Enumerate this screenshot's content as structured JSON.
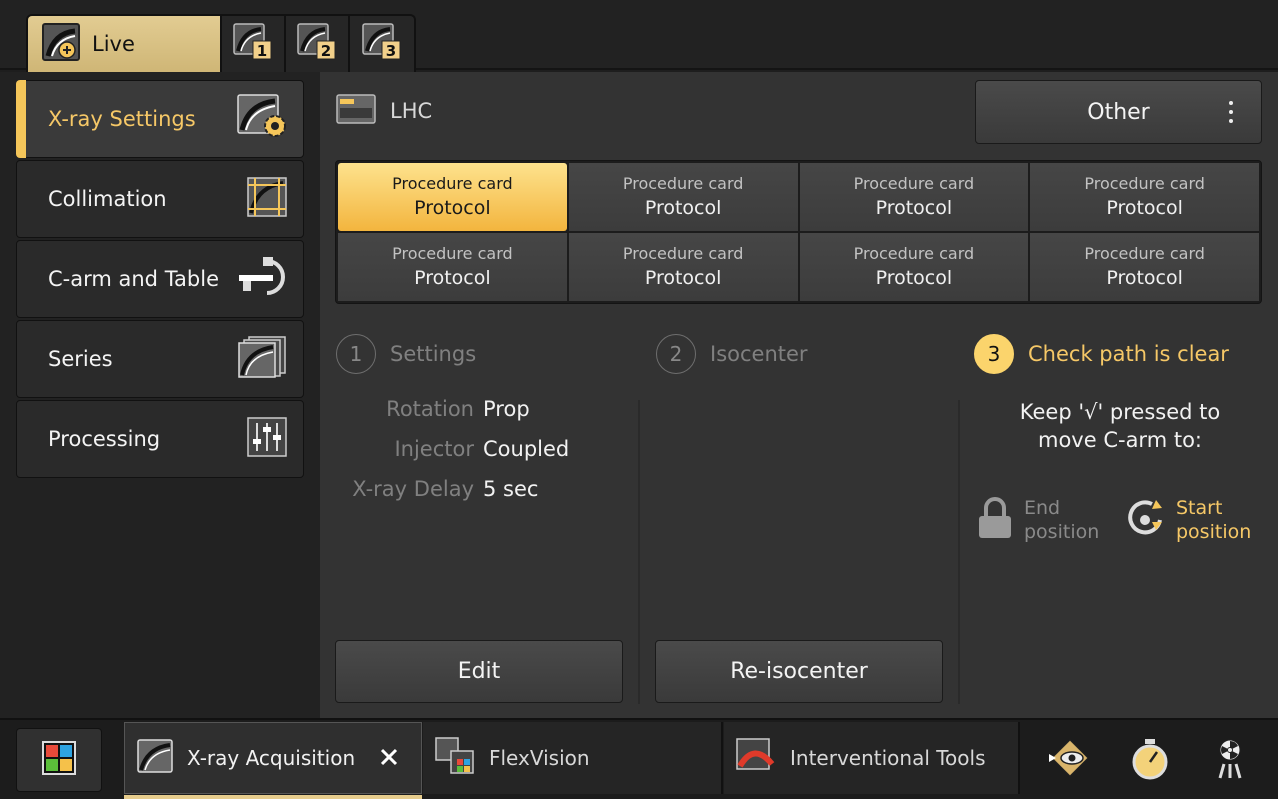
{
  "top_tabs": [
    {
      "label": "Live",
      "icon": "live-acquisition-icon",
      "active": true
    },
    {
      "number": "1",
      "icon": "viewport-1-icon"
    },
    {
      "number": "2",
      "icon": "viewport-2-icon"
    },
    {
      "number": "3",
      "icon": "viewport-3-icon"
    }
  ],
  "left_menu": [
    {
      "label": "X-ray Settings",
      "icon": "xray-settings-gear-icon",
      "active": true
    },
    {
      "label": "Collimation",
      "icon": "collimation-icon"
    },
    {
      "label": "C-arm and Table",
      "icon": "c-arm-table-icon"
    },
    {
      "label": "Series",
      "icon": "series-icon"
    },
    {
      "label": "Processing",
      "icon": "processing-sliders-icon"
    }
  ],
  "header": {
    "procedure": "LHC",
    "other_label": "Other"
  },
  "procedure_cards": [
    {
      "title": "Procedure card",
      "subtitle": "Protocol",
      "selected": true
    },
    {
      "title": "Procedure card",
      "subtitle": "Protocol"
    },
    {
      "title": "Procedure card",
      "subtitle": "Protocol"
    },
    {
      "title": "Procedure card",
      "subtitle": "Protocol"
    },
    {
      "title": "Procedure card",
      "subtitle": "Protocol"
    },
    {
      "title": "Procedure card",
      "subtitle": "Protocol"
    },
    {
      "title": "Procedure card",
      "subtitle": "Protocol"
    },
    {
      "title": "Procedure card",
      "subtitle": "Protocol"
    }
  ],
  "steps": [
    {
      "number": "1",
      "label": "Settings",
      "active": false
    },
    {
      "number": "2",
      "label": "Isocenter",
      "active": false
    },
    {
      "number": "3",
      "label": "Check path is clear",
      "active": true
    }
  ],
  "settings": [
    {
      "key": "Rotation",
      "value": "Prop"
    },
    {
      "key": "Injector",
      "value": "Coupled"
    },
    {
      "key": "X-ray Delay",
      "value": "5 sec"
    }
  ],
  "check_path": {
    "instruction_line1": "Keep '√' pressed to",
    "instruction_line2": "move C-arm to:",
    "end_line1": "End",
    "end_line2": "position",
    "start_line1": "Start",
    "start_line2": "position"
  },
  "actions": {
    "edit": "Edit",
    "reisocenter": "Re-isocenter"
  },
  "taskbar": {
    "apps": [
      {
        "label": "X-ray Acquisition",
        "active": true
      },
      {
        "label": "FlexVision"
      },
      {
        "label": "Interventional Tools"
      }
    ]
  },
  "colors": {
    "accent": "#f6c867",
    "selected_card": "#f3b53e",
    "live_tab": "#d8c082",
    "background": "#333333"
  }
}
